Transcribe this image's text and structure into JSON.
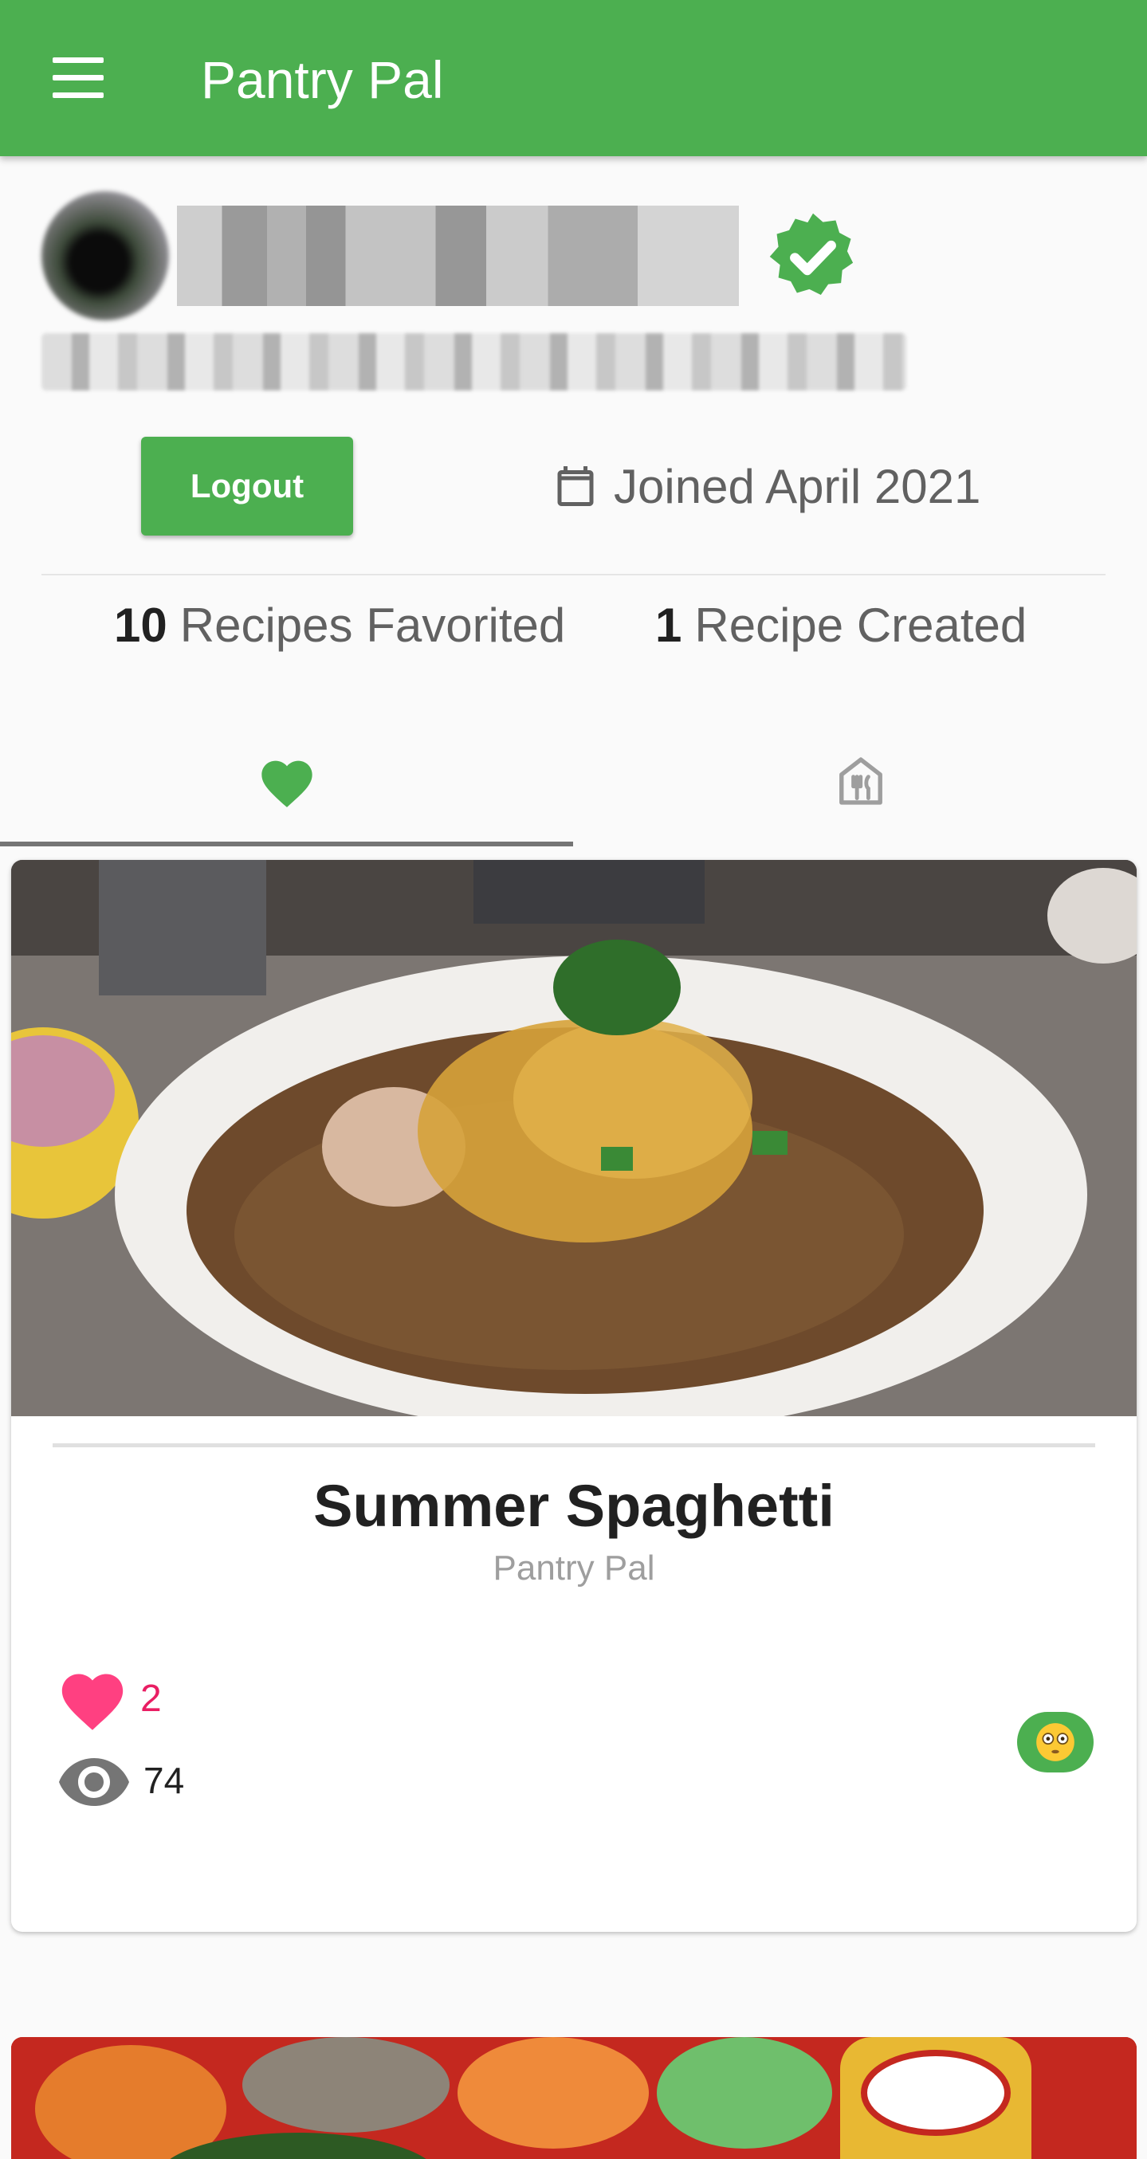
{
  "app_bar": {
    "title": "Pantry Pal",
    "icon": "menu-icon"
  },
  "profile": {
    "avatar": "user-avatar-blurred",
    "verified_icon": "verified-badge-icon",
    "logout_label": "Logout",
    "joined_icon": "calendar-icon",
    "joined_text": "Joined April 2021"
  },
  "stats": {
    "favorited_count": "10",
    "favorited_label": "Recipes Favorited",
    "created_count": "1",
    "created_label": "Recipe Created"
  },
  "tabs": [
    {
      "icon": "heart-icon",
      "selected": true
    },
    {
      "icon": "restaurant-icon",
      "selected": false
    }
  ],
  "recipes": [
    {
      "title": "Summer Spaghetti",
      "author": "Pantry Pal",
      "likes": "2",
      "views": "74",
      "reaction": "😳"
    }
  ],
  "colors": {
    "primary": "#4caf50",
    "like": "#e91e63",
    "muted": "#757575"
  }
}
